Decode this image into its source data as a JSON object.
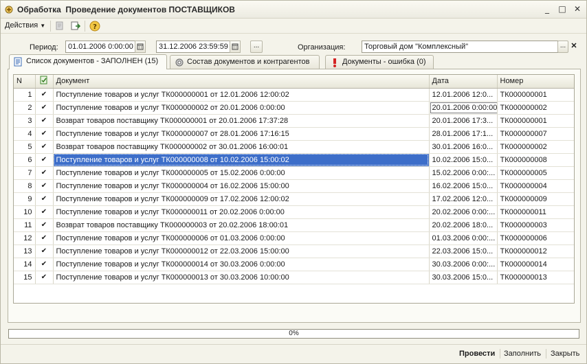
{
  "window": {
    "type_label": "Обработка",
    "title": "Проведение документов ПОСТАВЩИКОВ",
    "controls": [
      "_",
      "□",
      "✕"
    ]
  },
  "toolbar": {
    "actions_label": "Действия",
    "icons": [
      "refresh-icon",
      "export-icon",
      "help-icon"
    ]
  },
  "filters": {
    "period_label": "Период:",
    "date_from": "01.01.2006  0:00:00",
    "date_to": "31.12.2006 23:59:59",
    "period_button": "...",
    "org_label": "Организация:",
    "org_value": "Торговый дом \"Комплексный\"",
    "org_select_button": "...",
    "org_clear_button": "✕"
  },
  "tabs": [
    {
      "label": "Список документов - ЗАПОЛНЕН (15)",
      "icon": "document-list-icon",
      "active": true
    },
    {
      "label": "Состав документов и контрагентов",
      "icon": "gear-icon",
      "active": false
    },
    {
      "label": "Документы - ошибка (0)",
      "icon": "error-icon",
      "active": false
    }
  ],
  "table": {
    "columns": [
      "N",
      "",
      "Документ",
      "Дата",
      "Номер"
    ],
    "check_icon": "✔",
    "rows": [
      {
        "n": "1",
        "doc": "Поступление товаров и услуг ТК000000001 от 12.01.2006 12:00:02",
        "date": "12.01.2006 12:0...",
        "num": "ТК000000001"
      },
      {
        "n": "2",
        "doc": "Поступление товаров и услуг ТК000000002 от 20.01.2006 0:00:00",
        "date": "20.01.2006 0:00:00",
        "num": "ТК000000002"
      },
      {
        "n": "3",
        "doc": "Возврат товаров поставщику ТК000000001 от 20.01.2006 17:37:28",
        "date": "20.01.2006 17:3...",
        "num": "ТК000000001"
      },
      {
        "n": "4",
        "doc": "Поступление товаров и услуг ТК000000007 от 28.01.2006 17:16:15",
        "date": "28.01.2006 17:1...",
        "num": "ТК000000007"
      },
      {
        "n": "5",
        "doc": "Возврат товаров поставщику ТК000000002 от 30.01.2006 16:00:01",
        "date": "30.01.2006 16:0...",
        "num": "ТК000000002"
      },
      {
        "n": "6",
        "doc": "Поступление товаров и услуг ТК000000008 от 10.02.2006 15:00:02",
        "date": "10.02.2006 15:0...",
        "num": "ТК000000008"
      },
      {
        "n": "7",
        "doc": "Поступление товаров и услуг ТК000000005 от 15.02.2006 0:00:00",
        "date": "15.02.2006 0:00:...",
        "num": "ТК000000005"
      },
      {
        "n": "8",
        "doc": "Поступление товаров и услуг ТК000000004 от 16.02.2006 15:00:00",
        "date": "16.02.2006 15:0...",
        "num": "ТК000000004"
      },
      {
        "n": "9",
        "doc": "Поступление товаров и услуг ТК000000009 от 17.02.2006 12:00:02",
        "date": "17.02.2006 12:0...",
        "num": "ТК000000009"
      },
      {
        "n": "10",
        "doc": "Поступление товаров и услуг ТК000000011 от 20.02.2006 0:00:00",
        "date": "20.02.2006 0:00:...",
        "num": "ТК000000011"
      },
      {
        "n": "11",
        "doc": "Возврат товаров поставщику ТК000000003 от 20.02.2006 18:00:01",
        "date": "20.02.2006 18:0...",
        "num": "ТК000000003"
      },
      {
        "n": "12",
        "doc": "Поступление товаров и услуг ТК000000006 от 01.03.2006 0:00:00",
        "date": "01.03.2006 0:00:...",
        "num": "ТК000000006"
      },
      {
        "n": "13",
        "doc": "Поступление товаров и услуг ТК000000012 от 22.03.2006 15:00:00",
        "date": "22.03.2006 15:0...",
        "num": "ТК000000012"
      },
      {
        "n": "14",
        "doc": "Поступление товаров и услуг ТК000000014 от 30.03.2006 0:00:00",
        "date": "30.03.2006 0:00:...",
        "num": "ТК000000014"
      },
      {
        "n": "15",
        "doc": "Поступление товаров и услуг ТК000000013 от 30.03.2006 10:00:00",
        "date": "30.03.2006 15:0...",
        "num": "ТК000000013"
      }
    ],
    "selected_row": 6,
    "focused_date_row": 2
  },
  "progress": {
    "text": "0%",
    "value": 0
  },
  "footer": {
    "post_label": "Провести",
    "fill_label": "Заполнить",
    "close_label": "Закрыть"
  },
  "colors": {
    "selection": "#3d6ec9",
    "background": "#f4f3ea"
  }
}
